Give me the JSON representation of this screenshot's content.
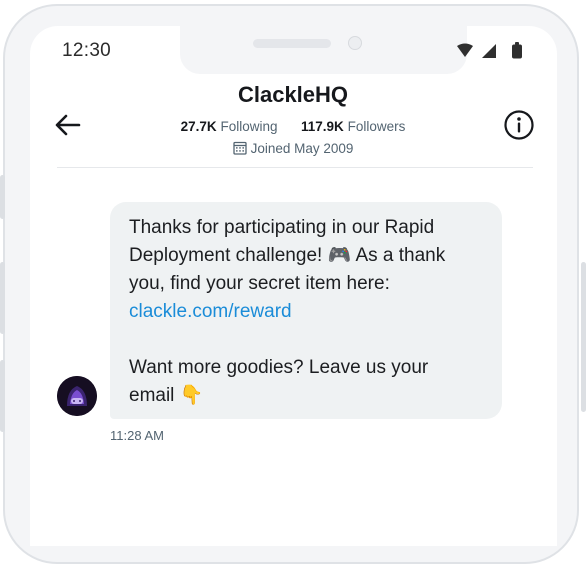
{
  "status_bar": {
    "time": "12:30",
    "icons": [
      "wifi-icon",
      "cell-signal-icon",
      "battery-icon"
    ]
  },
  "header": {
    "name": "ClackleHQ",
    "following_count": "27.7K",
    "following_label": "Following",
    "followers_count": "117.9K",
    "followers_label": "Followers",
    "joined": "Joined May 2009",
    "back_icon": "arrow-left-icon",
    "info_icon": "info-icon",
    "calendar_icon": "calendar-icon"
  },
  "message": {
    "line1": "Thanks for participating in our Rapid",
    "line2": "Deployment challenge! 🎮 As a thank",
    "line3": "you, find your secret item here:",
    "link": "clackle.com/reward",
    "line4": "Want more goodies? Leave us your",
    "line5": "email 👇",
    "timestamp": "11:28 AM"
  },
  "colors": {
    "link": "#1a8cd8",
    "bubble": "#eff2f3",
    "secondary_text": "#536471",
    "avatar_accent": "#7a4ed1"
  }
}
